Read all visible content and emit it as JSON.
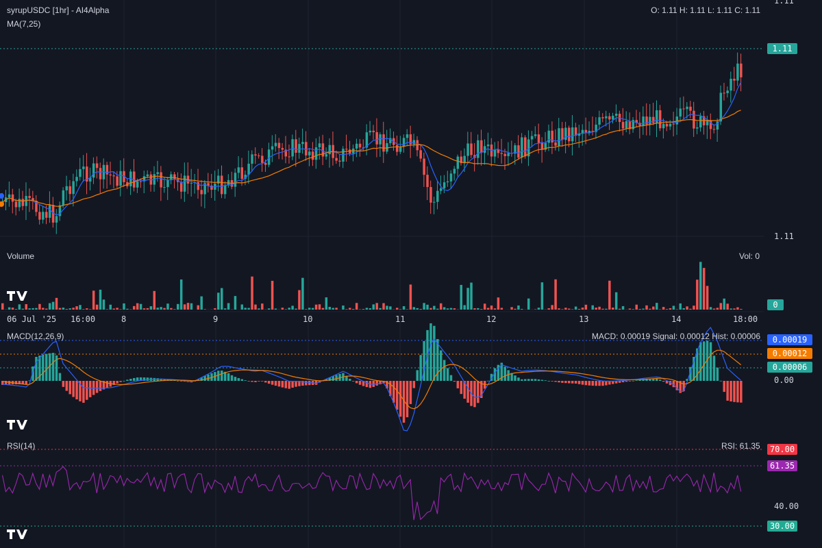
{
  "header": {
    "title": "syrupUSDC [1hr] - AI4Alpha",
    "ma_label": "MA(7,25)",
    "ohlc": "O: 1.11 H: 1.11 L: 1.11 C: 1.11"
  },
  "price_axis": {
    "top": "1.11",
    "bottom": "1.11",
    "last": "1.11"
  },
  "volume_panel": {
    "title": "Volume",
    "readout": "Vol: 0",
    "last": "0"
  },
  "time_axis": [
    "06 Jul '25",
    "16:00",
    "8",
    "9",
    "10",
    "11",
    "12",
    "13",
    "14",
    "18:00"
  ],
  "macd_panel": {
    "title": "MACD(12,26,9)",
    "readout": "MACD: 0.00019 Signal: 0.00012 Hist: 0.00006",
    "macd_tag": "0.00019",
    "signal_tag": "0.00012",
    "hist_tag": "0.00006",
    "zero": "0.00"
  },
  "rsi_panel": {
    "title": "RSI(14)",
    "readout": "RSI: 61.35",
    "tag_70": "70.00",
    "tag_value": "61.35",
    "level_40": "40.00",
    "tag_30": "30.00"
  },
  "colors": {
    "background": "#131722",
    "up": "#26a69a",
    "down": "#ef5350",
    "ma7": "#2962ff",
    "ma25": "#f57c00",
    "rsi": "#9c27b0",
    "rsi_over": "#f23645",
    "rsi_under": "#22ab94"
  },
  "chart_data": {
    "type": "candlestick",
    "symbol": "syrupUSDC",
    "interval": "1hr",
    "indicators": [
      "MA(7,25)",
      "Volume",
      "MACD(12,26,9)",
      "RSI(14)"
    ],
    "price_range": [
      1.11,
      1.11
    ],
    "last": {
      "open": 1.11,
      "high": 1.11,
      "low": 1.11,
      "close": 1.11,
      "volume": 0
    },
    "macd": {
      "macd": 0.00019,
      "signal": 0.00012,
      "hist": 6e-05
    },
    "rsi": {
      "value": 61.35,
      "upper": 70,
      "lower": 30
    }
  }
}
